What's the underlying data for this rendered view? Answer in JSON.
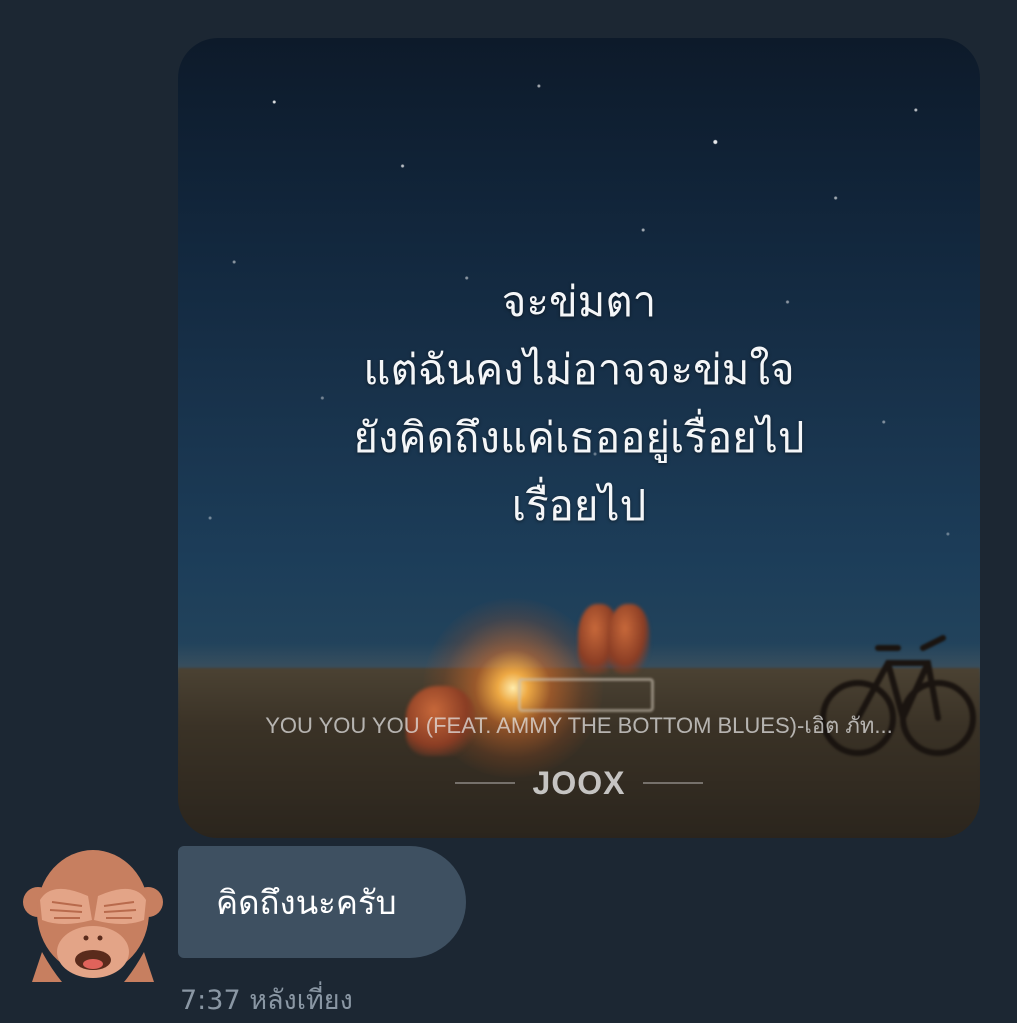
{
  "image_message": {
    "lyrics_lines": [
      "จะข่มตา",
      "แต่ฉันคงไม่อาจจะข่มใจ",
      "ยังคิดถึงแค่เธออยู่เรื่อยไป",
      "เรื่อยไป"
    ],
    "song_title": "YOU YOU YOU (FEAT. AMMY THE BOTTOM BLUES)-เอิต ภัท...",
    "brand_logo": "JOOX"
  },
  "text_message": {
    "text": "คิดถึงนะครับ"
  },
  "timestamp": "7:37 หลังเที่ยง",
  "sender_avatar": {
    "icon": "see-no-evil-monkey-icon"
  },
  "colors": {
    "background": "#1c2733",
    "bubble": "#3e5061",
    "timestamp": "#8a97a4"
  }
}
